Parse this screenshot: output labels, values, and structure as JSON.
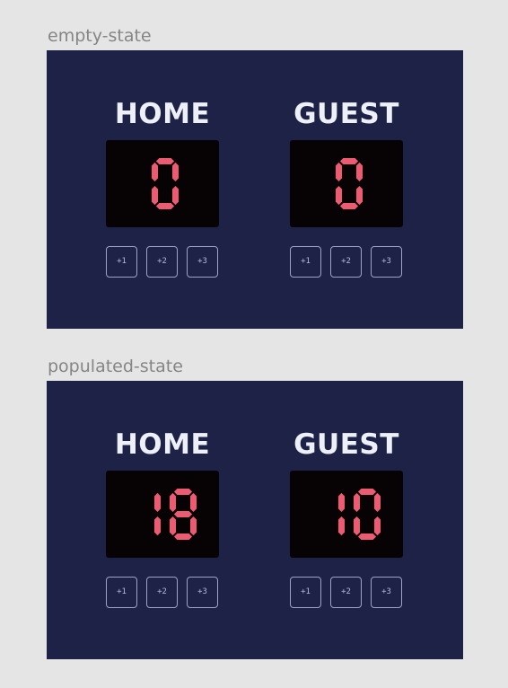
{
  "colors": {
    "canvas": "#e5e5e5",
    "panel": "#1e2247",
    "display": "#070305",
    "digit_on": "#ec5b72",
    "team_text": "#eef0f7",
    "button_border": "#9da2c6"
  },
  "frames": [
    {
      "label": "empty-state",
      "home": {
        "name": "HOME",
        "score": "0",
        "buttons": [
          "+1",
          "+2",
          "+3"
        ]
      },
      "guest": {
        "name": "GUEST",
        "score": "0",
        "buttons": [
          "+1",
          "+2",
          "+3"
        ]
      }
    },
    {
      "label": "populated-state",
      "home": {
        "name": "HOME",
        "score": "18",
        "buttons": [
          "+1",
          "+2",
          "+3"
        ]
      },
      "guest": {
        "name": "GUEST",
        "score": "10",
        "buttons": [
          "+1",
          "+2",
          "+3"
        ]
      }
    }
  ]
}
